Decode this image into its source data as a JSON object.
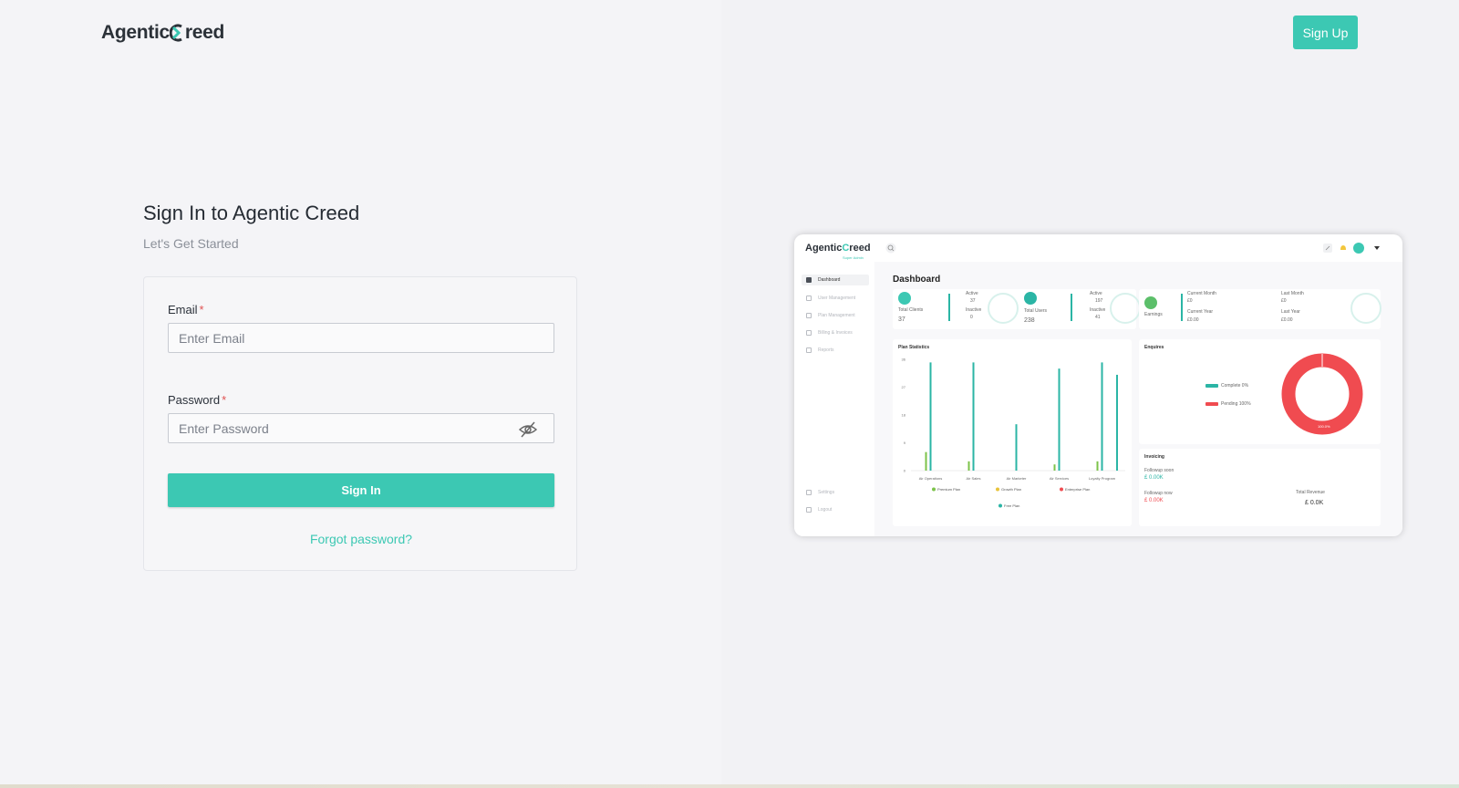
{
  "header": {
    "logo_text_left": "Agentic",
    "logo_text_right": "reed",
    "signup_label": "Sign Up"
  },
  "login": {
    "title": "Sign In to Agentic Creed",
    "subtitle": "Let's Get Started",
    "email_label": "Email",
    "email_placeholder": "Enter Email",
    "password_label": "Password",
    "password_placeholder": "Enter Password",
    "required_mark": "*",
    "signin_label": "Sign In",
    "forgot_label": "Forgot password?"
  },
  "preview": {
    "logo_left": "Agentic",
    "logo_right": "reed",
    "logo_tag": "Super Admin",
    "nav": [
      "Dashboard",
      "User Management",
      "Plan Management",
      "Billing & Invoices",
      "Reports"
    ],
    "settings": "Settings",
    "logout": "Logout",
    "dashboard_title": "Dashboard",
    "stats": {
      "clients_label": "Total Clients",
      "clients_value": "37",
      "clients_active": "Active",
      "clients_active_value": "37",
      "clients_inactive": "Inactive",
      "clients_inactive_value": "0",
      "users_label": "Total Users",
      "users_value": "238",
      "users_active": "Active",
      "users_active_value": "197",
      "users_inactive": "Inactive",
      "users_inactive_value": "41",
      "earnings_label": "Earnings",
      "current_month": "Current Month",
      "current_month_value": "£0",
      "last_month": "Last Month",
      "last_month_value": "£0",
      "current_year": "Current Year",
      "current_year_value": "£0.00",
      "last_year": "Last Year",
      "last_year_value": "£0.00"
    },
    "plan_stats_title": "Plan Statistics",
    "enquires_title": "Enquires",
    "enquires_legend": [
      "Complete 0%",
      "Pending 100%"
    ],
    "donut_label": "100.0%",
    "invoicing_title": "Invoicing",
    "followup_soon": "Followup soon",
    "followup_soon_value": "£ 0.00K",
    "followup_now": "Followup now",
    "followup_now_value": "£ 0.00K",
    "total_revenue": "Total Revenue",
    "total_revenue_value": "£ 0.0K",
    "colors": {
      "teal": "#2bb5a5",
      "green": "#7cc34a",
      "red": "#f04b50",
      "accent": "#3cc8b3"
    }
  },
  "chart_data": {
    "type": "bar",
    "title": "Plan Statistics",
    "categories": [
      "Air Operations",
      "Air Sales",
      "Air Marketer",
      "Air Services",
      "Loyalty Program"
    ],
    "yticks": [
      0,
      9,
      18,
      27,
      36
    ],
    "ylim": [
      0,
      36
    ],
    "series": [
      {
        "name": "Premium Plan",
        "color": "#7cc34a",
        "values": [
          6,
          3,
          0,
          2,
          3
        ]
      },
      {
        "name": "Growth Plan",
        "color": "#e8c33a",
        "values": [
          0,
          0,
          0,
          0,
          0
        ]
      },
      {
        "name": "Enterprise Plan",
        "color": "#f04b50",
        "values": [
          0,
          0,
          0,
          0,
          0
        ]
      },
      {
        "name": "Free Plan",
        "color": "#2bb5a5",
        "values": [
          35,
          35,
          15,
          33,
          35
        ]
      }
    ],
    "extra_free_bar": 31
  }
}
